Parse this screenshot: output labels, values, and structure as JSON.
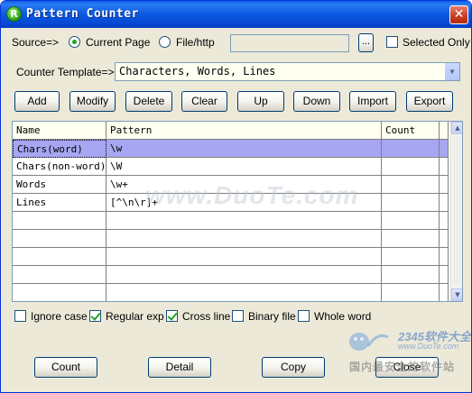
{
  "window": {
    "title": "Pattern Counter",
    "icon_letter": "R",
    "close_glyph": "✕"
  },
  "source": {
    "label": "Source=>",
    "options": [
      {
        "label": "Current Page",
        "selected": true
      },
      {
        "label": "File/http",
        "selected": false
      }
    ],
    "path_value": "",
    "browse_label": "...",
    "selected_only": {
      "label": "Selected Only",
      "checked": false
    }
  },
  "template": {
    "label": "Counter Template=>",
    "value": "Characters, Words, Lines",
    "arrow": "▼"
  },
  "toolbar": [
    "Add",
    "Modify",
    "Delete",
    "Clear",
    "Up",
    "Down",
    "Import",
    "Export"
  ],
  "grid": {
    "columns": [
      "Name",
      "Pattern",
      "Count"
    ],
    "rows": [
      {
        "name": "Chars(word)",
        "pattern": "\\w",
        "count": "",
        "selected": true
      },
      {
        "name": "Chars(non-word)",
        "pattern": "\\W",
        "count": ""
      },
      {
        "name": "Words",
        "pattern": "\\w+",
        "count": ""
      },
      {
        "name": "Lines",
        "pattern": "[^\\n\\r]+",
        "count": ""
      },
      {
        "name": "",
        "pattern": "",
        "count": ""
      },
      {
        "name": "",
        "pattern": "",
        "count": ""
      },
      {
        "name": "",
        "pattern": "",
        "count": ""
      },
      {
        "name": "",
        "pattern": "",
        "count": ""
      },
      {
        "name": "",
        "pattern": "",
        "count": ""
      }
    ],
    "scroll_up": "▲",
    "scroll_down": "▼"
  },
  "options": [
    {
      "label": "Ignore case",
      "checked": false
    },
    {
      "label": "Regular exp",
      "checked": true
    },
    {
      "label": "Cross line",
      "checked": true
    },
    {
      "label": "Binary file",
      "checked": false
    },
    {
      "label": "Whole word",
      "checked": false
    }
  ],
  "bottom_buttons": [
    "Count",
    "Detail",
    "Copy",
    "Close"
  ],
  "watermarks": {
    "center": "www.DuoTe.com",
    "brand": "2345软件大全",
    "url": "www.DuoTe.com",
    "slogan": "国内最安全的软件站"
  },
  "colors": {
    "titlebar": "#0548d3",
    "selection": "#a6a6f2",
    "header_bg": "#fffff0",
    "check_green": "#21a121"
  }
}
